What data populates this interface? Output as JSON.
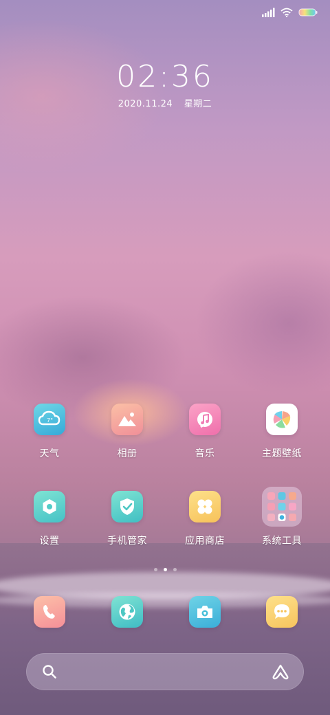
{
  "status_bar": {
    "icons": [
      "signal-icon",
      "wifi-icon",
      "battery-icon"
    ]
  },
  "lock": {
    "time": "02:36",
    "date": "2020.11.24",
    "weekday": "星期二"
  },
  "apps": [
    {
      "label": "天气",
      "icon": "weather-icon"
    },
    {
      "label": "相册",
      "icon": "gallery-icon"
    },
    {
      "label": "音乐",
      "icon": "music-icon"
    },
    {
      "label": "主题壁纸",
      "icon": "themes-icon"
    },
    {
      "label": "设置",
      "icon": "settings-icon"
    },
    {
      "label": "手机管家",
      "icon": "security-icon"
    },
    {
      "label": "应用商店",
      "icon": "app-store-icon"
    },
    {
      "label": "系统工具",
      "icon": "folder-icon"
    }
  ],
  "weather_icon_text": "7°",
  "page_indicator": {
    "pages": 3,
    "current": 2
  },
  "dock": [
    {
      "icon": "phone-icon"
    },
    {
      "icon": "browser-icon"
    },
    {
      "icon": "camera-icon"
    },
    {
      "icon": "messages-icon"
    }
  ],
  "search_bar": {
    "left_icon": "search-icon",
    "right_icon": "assistant-icon"
  },
  "colors": {
    "weather": "#3fb8d8",
    "gallery": "#f4a59a",
    "music": "#f07eb5",
    "themes": "#ffffff",
    "settings": "#5ed4c8",
    "security": "#58cfc4",
    "app_store": "#f9cf6b",
    "phone": "#f7a89a",
    "browser": "#5ecdc4",
    "camera": "#48bfd9",
    "messages": "#f9d278"
  }
}
